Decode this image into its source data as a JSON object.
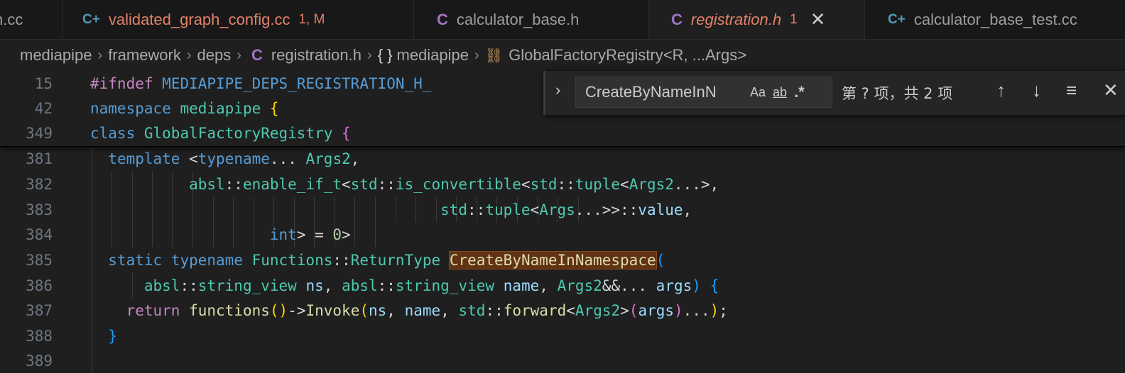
{
  "tabs": [
    {
      "icon": "",
      "name": "n.cc",
      "badge": ""
    },
    {
      "icon": "C+",
      "name": "validated_graph_config.cc",
      "badge": "1, M"
    },
    {
      "icon": "C",
      "name": "calculator_base.h",
      "badge": ""
    },
    {
      "icon": "C",
      "name": "registration.h",
      "badge": "1",
      "close": "✕"
    },
    {
      "icon": "C+",
      "name": "calculator_base_test.cc",
      "badge": ""
    }
  ],
  "breadcrumb": {
    "items": [
      "mediapipe",
      "framework",
      "deps",
      "registration.h",
      "mediapipe",
      "GlobalFactoryRegistry<R, ...Args>"
    ],
    "c_icon": "C",
    "brace_icon": "{ }",
    "class_icon": "⛓"
  },
  "find": {
    "toggle": "›",
    "query": "CreateByNameInN",
    "match_case": "Aa",
    "whole_word": "ab",
    "regex": ".*",
    "count": "第 ? 项，共 2 项",
    "prev": "↑",
    "next": "↓",
    "selection": "≡",
    "close": "✕"
  },
  "editor": {
    "line_numbers": [
      "15",
      "42",
      "349",
      "381",
      "382",
      "383",
      "384",
      "385",
      "386",
      "387",
      "388",
      "389"
    ]
  }
}
